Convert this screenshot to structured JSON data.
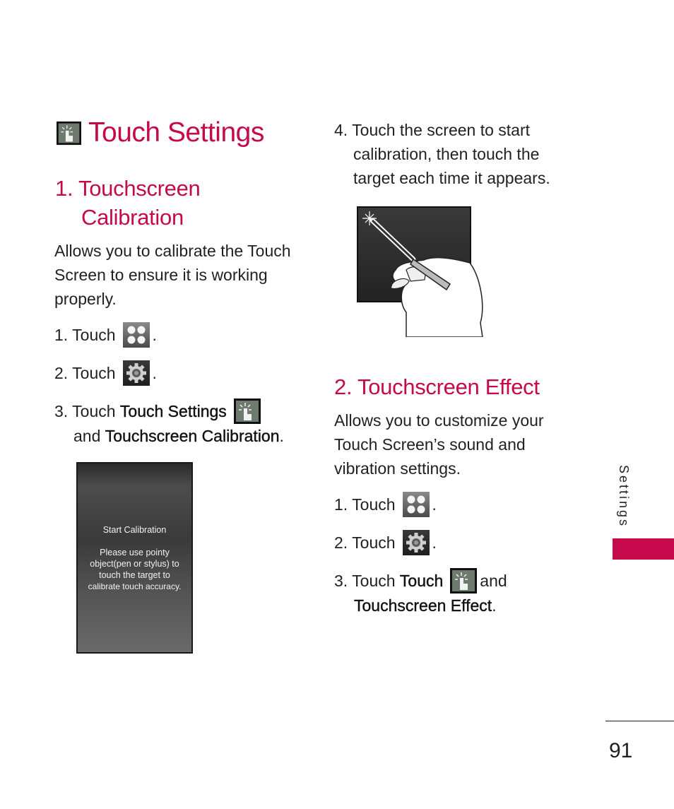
{
  "page": {
    "title": "Touch Settings",
    "title_icon": "touch-settings-icon",
    "side_tab_label": "Settings",
    "page_number": "91",
    "accent_color": "#c5094b"
  },
  "section1": {
    "heading_num": "1.",
    "heading_line1": "Touchscreen",
    "heading_line2": "Calibration",
    "description": "Allows you to calibrate the Touch Screen to ensure it is working properly.",
    "steps": [
      {
        "prefix": "1. Touch",
        "icon": "menu-grid-icon",
        "suffix": "."
      },
      {
        "prefix": "2. Touch",
        "icon": "gear-settings-icon",
        "suffix": "."
      },
      {
        "prefix": "3. Touch",
        "bold1": "Touch Settings",
        "icon": "touch-settings-icon",
        "line2_prefix": "and",
        "bold2": "Touchscreen Calibration",
        "suffix": "."
      }
    ],
    "screenshot": {
      "heading": "Start Calibration",
      "line1": "Please use pointy",
      "line2": "object(pen or stylus) to",
      "line3": "touch the target to",
      "line4": "calibrate touch accuracy."
    },
    "step4_line1": "4. Touch the screen to start",
    "step4_line2": "calibration, then touch the",
    "step4_line3": "target each time it appears.",
    "illustration": "hand-stylus-illustration"
  },
  "section2": {
    "heading": "2. Touchscreen Effect",
    "description": "Allows you to customize your Touch Screen’s sound and vibration settings.",
    "steps": [
      {
        "prefix": "1. Touch",
        "icon": "menu-grid-icon",
        "suffix": "."
      },
      {
        "prefix": "2. Touch",
        "icon": "gear-settings-icon",
        "suffix": "."
      },
      {
        "prefix": "3. Touch",
        "bold1": "Touch",
        "icon": "touch-settings-icon",
        "after_icon": "and",
        "bold2": "Touchscreen Effect",
        "suffix": "."
      }
    ]
  }
}
